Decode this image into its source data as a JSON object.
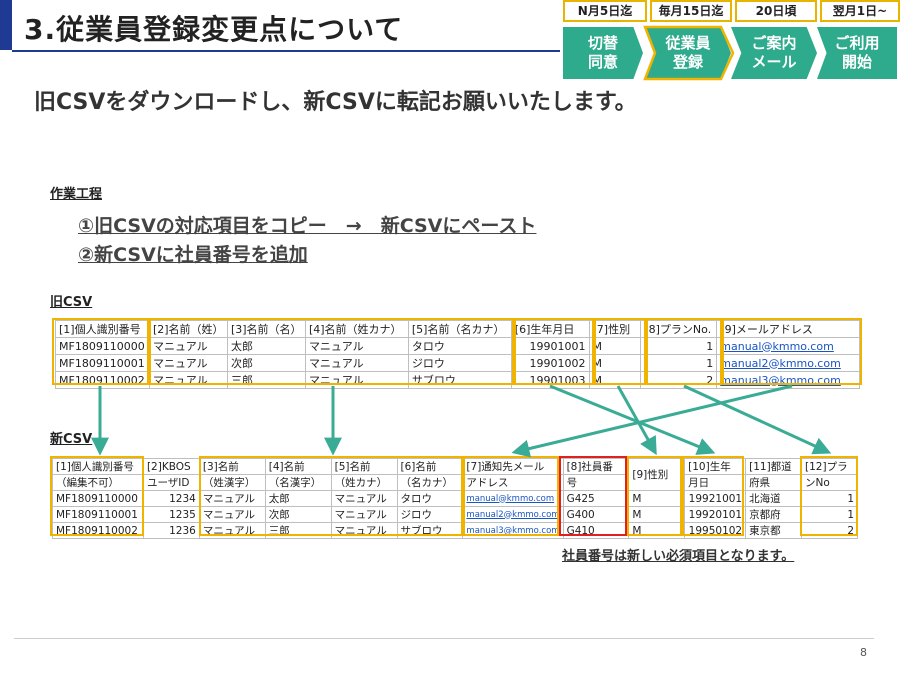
{
  "slide": {
    "title": "3.従業員登録変更点について",
    "headline": "旧CSVをダウンロードし、新CSVに転記お願いいたします。",
    "page_number": "8"
  },
  "timeline": {
    "dates": [
      "N月5日迄",
      "毎月15日迄",
      "20日頃",
      "翌月1日~"
    ],
    "steps": [
      "切替\n同意",
      "従業員\n登録",
      "ご案内\nメール",
      "ご利用\n開始"
    ],
    "current_step": "従業員\n登録"
  },
  "process": {
    "label": "作業工程",
    "step1": "①旧CSVの対応項目をコピー　→　新CSVにペースト",
    "step2": "②新CSVに社員番号を追加"
  },
  "old_csv": {
    "label": "旧CSV",
    "headers": [
      "[1]個人識別番号",
      "[2]名前（姓）",
      "[3]名前（名）",
      "[4]名前（姓カナ）",
      "[5]名前（名カナ）",
      "[6]生年月日",
      "[7]性別",
      "[8]プランNo.",
      "[9]メールアドレス"
    ],
    "rows": [
      [
        "MF1809110000",
        "マニュアル",
        "太郎",
        "マニュアル",
        "タロウ",
        "19901001",
        "M",
        "1",
        "manual@kmmo.com"
      ],
      [
        "MF1809110001",
        "マニュアル",
        "次郎",
        "マニュアル",
        "ジロウ",
        "19901002",
        "M",
        "1",
        "manual2@kmmo.com"
      ],
      [
        "MF1809110002",
        "マニュアル",
        "三郎",
        "マニュアル",
        "サブロウ",
        "19901003",
        "M",
        "2",
        "manual3@kmmo.com"
      ]
    ]
  },
  "new_csv": {
    "label": "新CSV",
    "headers_line1": [
      "[1]個人識別番号",
      "[2]KBOS",
      "[3]名前",
      "[4]名前",
      "[5]名前",
      "[6]名前",
      "[7]通知先メール",
      "[8]社員番",
      "[9]性別",
      "[10]生年",
      "[11]都道",
      "[12]プラ"
    ],
    "headers_line2": [
      "（編集不可）",
      "ユーザID",
      "（姓漢字）",
      "（名漢字）",
      "（姓カナ）",
      "（名カナ）",
      "アドレス",
      "号",
      "",
      "月日",
      "府県",
      "ンNo"
    ],
    "rows": [
      [
        "MF1809110000",
        "1234",
        "マニュアル",
        "太郎",
        "マニュアル",
        "タロウ",
        "manual@kmmo.com",
        "G425",
        "M",
        "19921001",
        "北海道",
        "1"
      ],
      [
        "MF1809110001",
        "1235",
        "マニュアル",
        "次郎",
        "マニュアル",
        "ジロウ",
        "manual2@kmmo.com",
        "G400",
        "M",
        "19920101",
        "京都府",
        "1"
      ],
      [
        "MF1809110002",
        "1236",
        "マニュアル",
        "三郎",
        "マニュアル",
        "サブロウ",
        "manual3@kmmo.com",
        "G410",
        "M",
        "19950102",
        "東京都",
        "2"
      ]
    ]
  },
  "note": "社員番号は新しい必須項目となります。",
  "colors": {
    "accent": "#1f3a93",
    "step": "#2eaa8c",
    "highlight": "#f0b400",
    "required": "#e02020",
    "arrow": "#3aab95"
  }
}
